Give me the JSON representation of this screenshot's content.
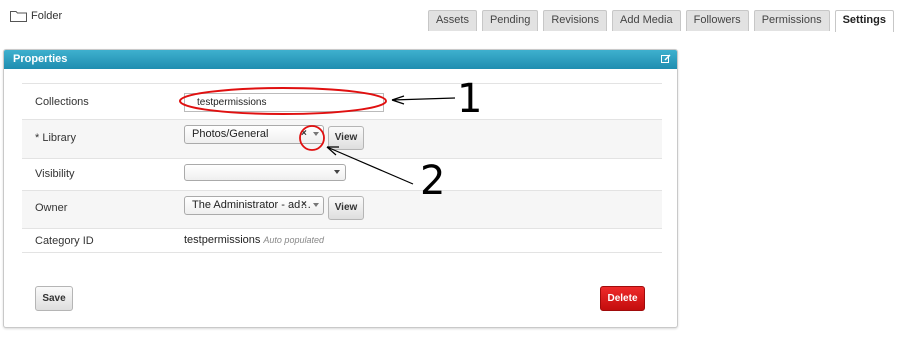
{
  "header": {
    "folder_label": "Folder",
    "tabs": [
      {
        "label": "Assets"
      },
      {
        "label": "Pending"
      },
      {
        "label": "Revisions"
      },
      {
        "label": "Add Media"
      },
      {
        "label": "Followers"
      },
      {
        "label": "Permissions"
      },
      {
        "label": "Settings",
        "active": true
      }
    ]
  },
  "panel": {
    "title": "Properties",
    "fields": {
      "collections": {
        "label": "Collections",
        "value": "testpermissions"
      },
      "library": {
        "label": "* Library",
        "value": "Photos/General",
        "view_label": "View"
      },
      "visibility": {
        "label": "Visibility",
        "value": ""
      },
      "owner": {
        "label": "Owner",
        "value": "The Administrator - ad…",
        "view_label": "View"
      },
      "category_id": {
        "label": "Category ID",
        "value": "testpermissions",
        "hint": "Auto populated"
      }
    },
    "save_label": "Save",
    "delete_label": "Delete"
  },
  "annotations": [
    {
      "number": "1"
    },
    {
      "number": "2"
    }
  ],
  "colors": {
    "header_accent": "#2a9cc0",
    "delete_button": "#d41414",
    "annotation_circle": "#e01010"
  }
}
